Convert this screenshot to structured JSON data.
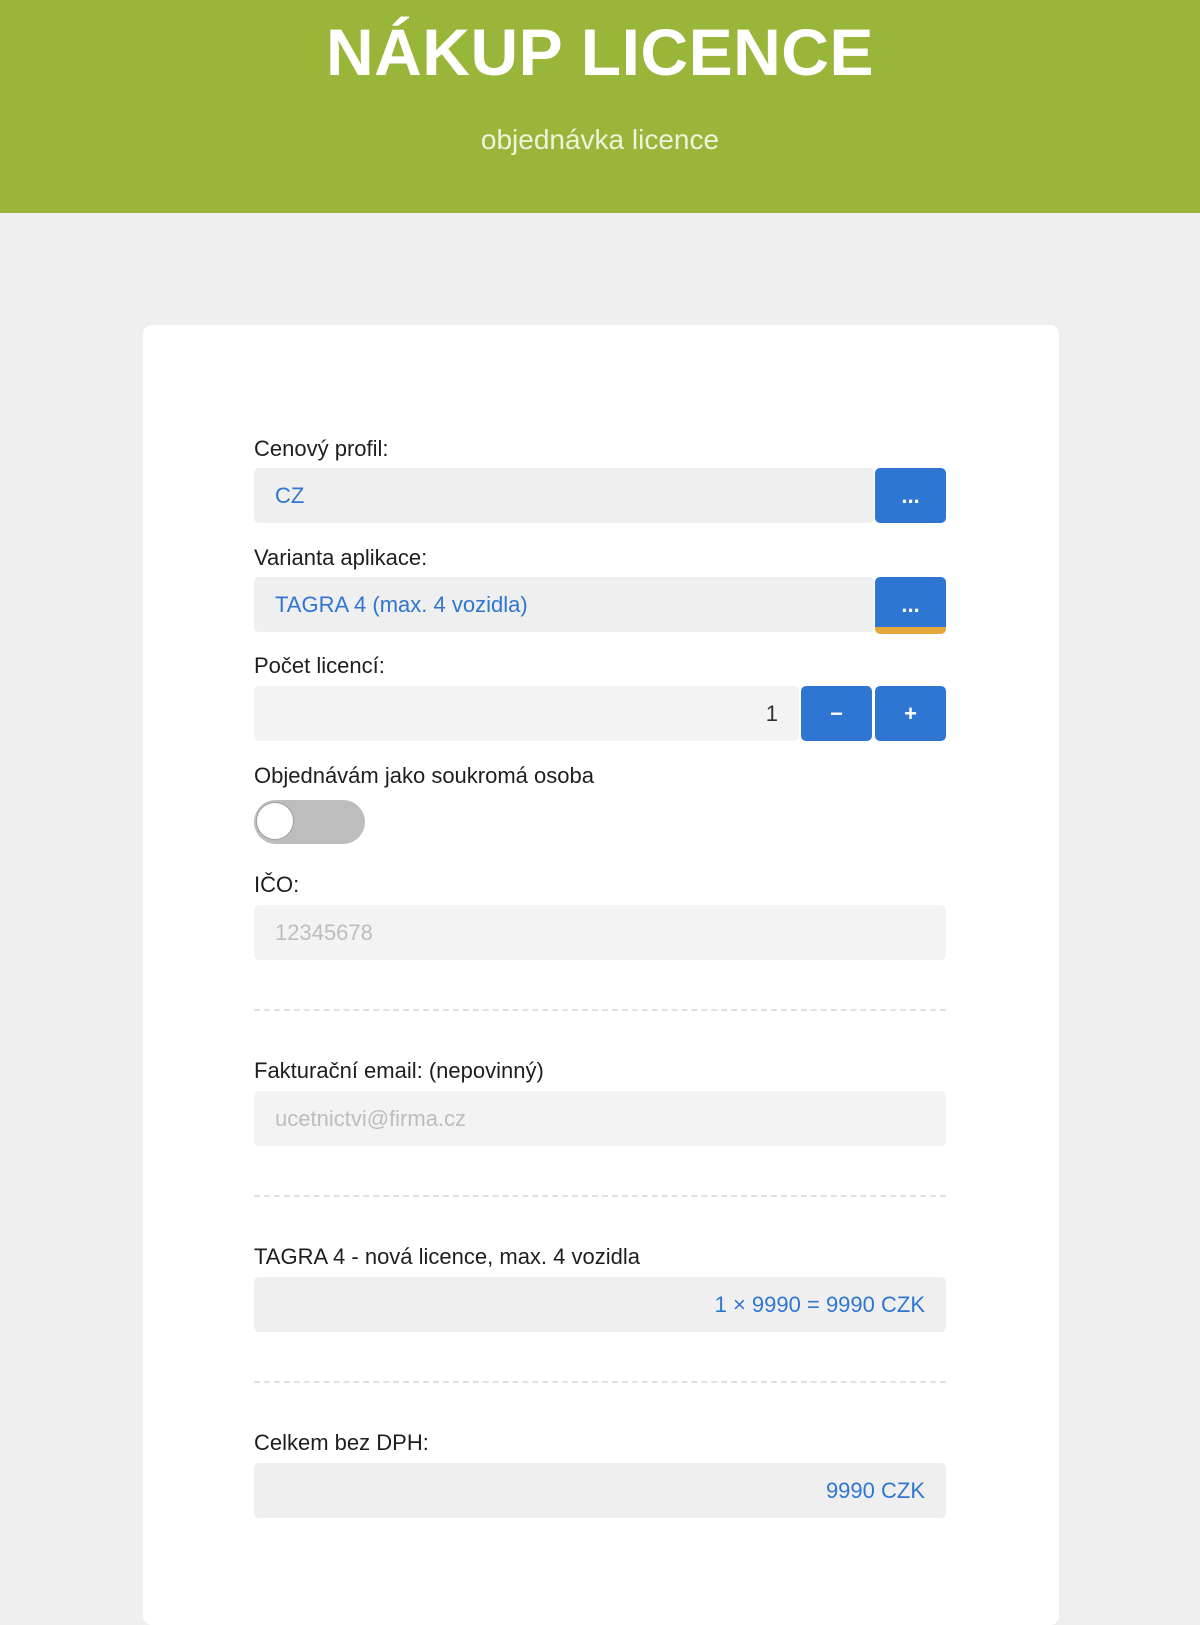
{
  "header": {
    "title": "NÁKUP LICENCE",
    "subtitle": "objednávka licence"
  },
  "form": {
    "price_profile": {
      "label": "Cenový profil:",
      "value": "CZ",
      "button_label": "..."
    },
    "app_variant": {
      "label": "Varianta aplikace:",
      "value": "TAGRA 4 (max. 4 vozidla)",
      "button_label": "..."
    },
    "license_count": {
      "label": "Počet licencí:",
      "value": "1",
      "decrement_label": "−",
      "increment_label": "+"
    },
    "private_person": {
      "label": "Objednávám jako soukromá osoba",
      "enabled": false
    },
    "ico": {
      "label": "IČO:",
      "placeholder": "12345678"
    },
    "billing_email": {
      "label": "Fakturační email: (nepovinný)",
      "placeholder": "ucetnictvi@firma.cz"
    },
    "line_item": {
      "label": "TAGRA 4 - nová licence, max. 4 vozidla",
      "value": "1 × 9990 = 9990 CZK"
    },
    "total": {
      "label": "Celkem bez DPH:",
      "value": "9990 CZK"
    }
  },
  "colors": {
    "header_bg": "#9ab63a",
    "accent_blue": "#2f76d2",
    "accent_orange": "#e5a93b",
    "page_bg": "#efefef"
  }
}
